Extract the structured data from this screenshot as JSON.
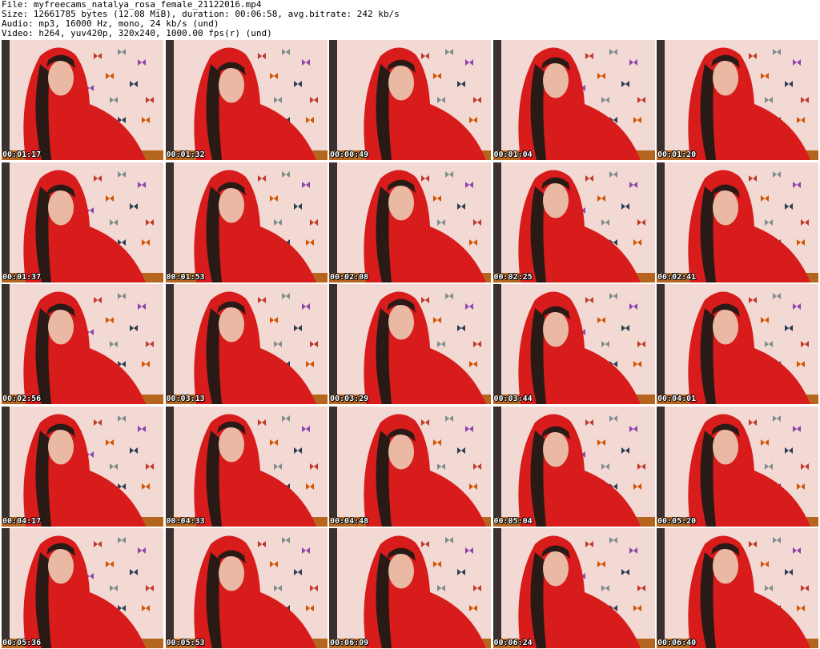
{
  "header": {
    "file_line": "File: myfreecams_natalya_rosa_female_21122016.mp4",
    "size_line": "Size: 12661785 bytes (12.08 MiB), duration: 00:06:58, avg.bitrate: 242 kb/s",
    "audio_line": "Audio: mp3, 16000 Hz, mono, 24 kb/s (und)",
    "video_line": "Video: h264, yuv420p, 320x240, 1000.00 fps(r) (und)"
  },
  "colors": {
    "background": "#ffffff",
    "wall": "#f3d9d4",
    "robe": "#d81c1c",
    "hair": "#2a1a16",
    "skin": "#e9b9a4",
    "timestamp_text": "#ffffff"
  },
  "thumbnails": [
    {
      "timestamp": "00:01:17"
    },
    {
      "timestamp": "00:01:32"
    },
    {
      "timestamp": "00:00:49"
    },
    {
      "timestamp": "00:01:04"
    },
    {
      "timestamp": "00:01:20"
    },
    {
      "timestamp": "00:01:37"
    },
    {
      "timestamp": "00:01:53"
    },
    {
      "timestamp": "00:02:08"
    },
    {
      "timestamp": "00:02:25"
    },
    {
      "timestamp": "00:02:41"
    },
    {
      "timestamp": "00:02:56"
    },
    {
      "timestamp": "00:03:13"
    },
    {
      "timestamp": "00:03:29"
    },
    {
      "timestamp": "00:03:44"
    },
    {
      "timestamp": "00:04:01"
    },
    {
      "timestamp": "00:04:17"
    },
    {
      "timestamp": "00:04:33"
    },
    {
      "timestamp": "00:04:48"
    },
    {
      "timestamp": "00:05:04"
    },
    {
      "timestamp": "00:05:20"
    },
    {
      "timestamp": "00:05:36"
    },
    {
      "timestamp": "00:05:53"
    },
    {
      "timestamp": "00:06:09"
    },
    {
      "timestamp": "00:06:24"
    },
    {
      "timestamp": "00:06:40"
    }
  ]
}
